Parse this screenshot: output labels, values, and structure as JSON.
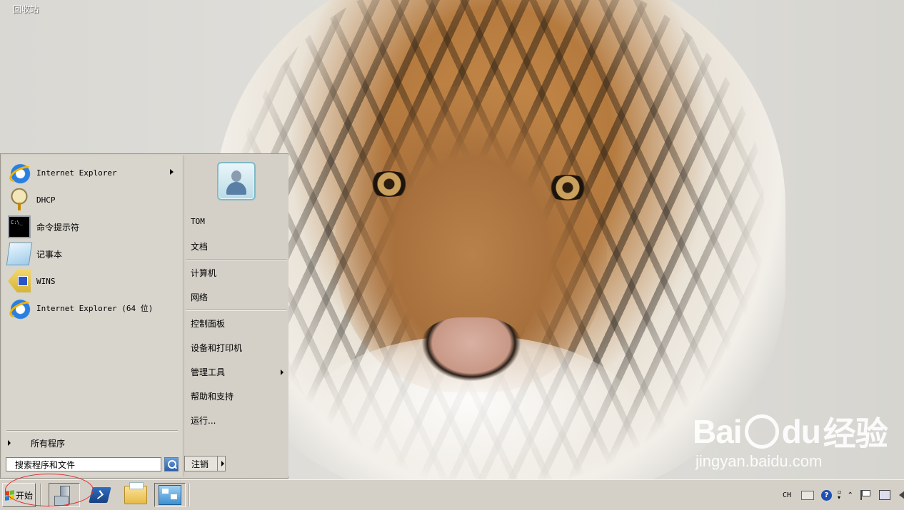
{
  "desktop": {
    "recycle_bin_label": "回收站",
    "watermark": {
      "logo_text_a": "Bai",
      "logo_text_b": "du",
      "logo_text_c": "经验",
      "url": "jingyan.baidu.com"
    }
  },
  "start_menu": {
    "programs": [
      {
        "label": "Internet Explorer",
        "icon": "ie-icon",
        "has_submenu": true
      },
      {
        "label": "DHCP",
        "icon": "dhcp-icon",
        "has_submenu": false
      },
      {
        "label": "命令提示符",
        "icon": "command-prompt-icon",
        "has_submenu": false
      },
      {
        "label": "记事本",
        "icon": "notepad-icon",
        "has_submenu": false
      },
      {
        "label": "WINS",
        "icon": "wins-icon",
        "has_submenu": false
      },
      {
        "label": "Internet Explorer (64 位)",
        "icon": "ie-icon",
        "has_submenu": false
      }
    ],
    "all_programs_label": "所有程序",
    "search": {
      "value": "搜索程序和文件"
    },
    "right_items": {
      "user": "TOM",
      "documents": "文档",
      "computer": "计算机",
      "network": "网络",
      "control_panel": "控制面板",
      "devices_printers": "设备和打印机",
      "admin_tools": "管理工具",
      "help_support": "帮助和支持",
      "run": "运行..."
    },
    "logoff_label": "注销"
  },
  "taskbar": {
    "start_label": "开始",
    "pinned": [
      "server-manager-icon",
      "powershell-icon",
      "explorer-folder-icon",
      "control-panel-icon"
    ],
    "tray": {
      "language": "CH",
      "help_glyph": "?"
    },
    "colors": {
      "annotation_circle": "#e0262b"
    }
  }
}
